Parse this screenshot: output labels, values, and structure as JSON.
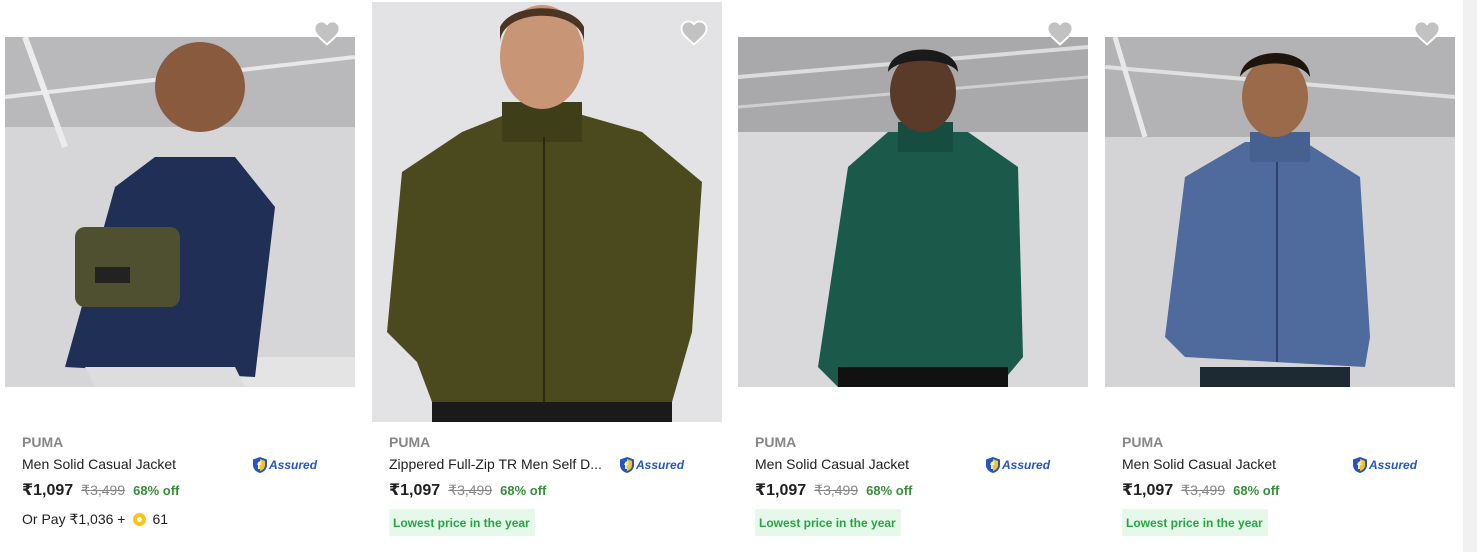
{
  "products": [
    {
      "brand": "PUMA",
      "title": "Men Solid Casual Jacket",
      "assured_label": "Assured",
      "price": "₹1,097",
      "mrp": "₹3,499",
      "discount": "68% off",
      "pay_prefix": "Or Pay ₹1,036 +",
      "pay_coins": "61",
      "badge": "",
      "jacket_color": "#1f2f55",
      "wishlisted": false
    },
    {
      "brand": "PUMA",
      "title": "Zippered Full-Zip TR Men Self D...",
      "assured_label": "Assured",
      "price": "₹1,097",
      "mrp": "₹3,499",
      "discount": "68% off",
      "pay_prefix": "",
      "pay_coins": "",
      "badge": "Lowest price in the year",
      "jacket_color": "#4a4a1e",
      "wishlisted": false
    },
    {
      "brand": "PUMA",
      "title": "Men Solid Casual Jacket",
      "assured_label": "Assured",
      "price": "₹1,097",
      "mrp": "₹3,499",
      "discount": "68% off",
      "pay_prefix": "",
      "pay_coins": "",
      "badge": "Lowest price in the year",
      "jacket_color": "#1b5a4a",
      "wishlisted": false
    },
    {
      "brand": "PUMA",
      "title": "Men Solid Casual Jacket",
      "assured_label": "Assured",
      "price": "₹1,097",
      "mrp": "₹3,499",
      "discount": "68% off",
      "pay_prefix": "",
      "pay_coins": "",
      "badge": "Lowest price in the year",
      "jacket_color": "#4f6a9c",
      "wishlisted": false
    }
  ],
  "icons": {
    "wishlist": "heart-icon",
    "assured": "shield-icon",
    "coin": "supercoin-icon"
  },
  "colors": {
    "price_green": "#388e3c",
    "badge_bg": "#e6f8ea",
    "badge_text": "#26a541",
    "assured_blue": "#2455c3"
  }
}
